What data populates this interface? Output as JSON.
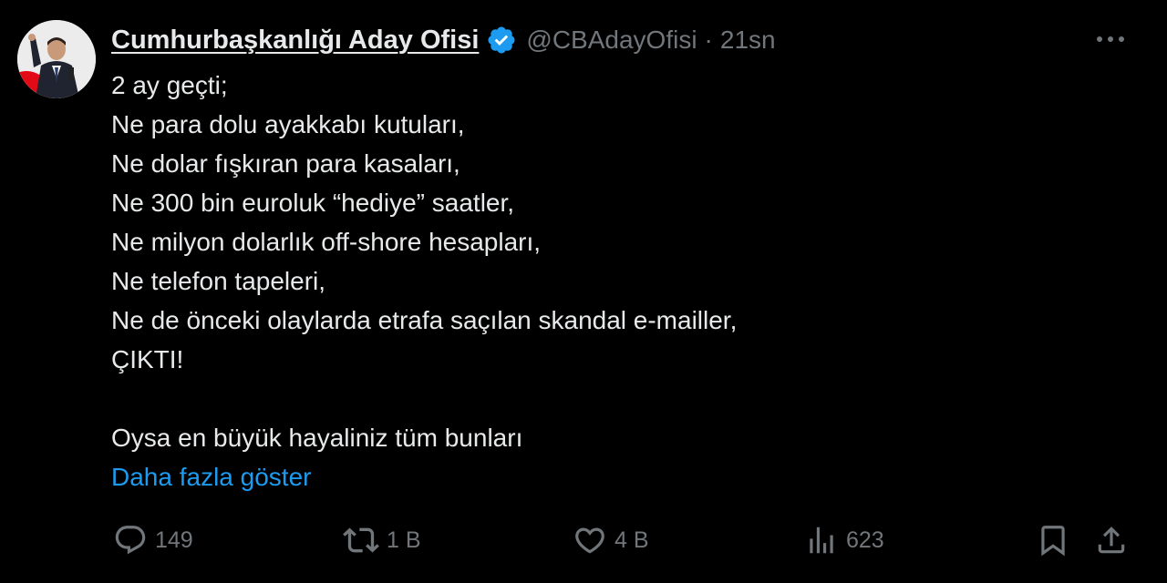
{
  "author": {
    "display_name": "Cumhurbaşkanlığı Aday Ofisi",
    "handle": "@CBAdayOfisi",
    "separator": "·",
    "time": "21sn",
    "verified_icon": "verified-badge-icon",
    "avatar": "profile-photo"
  },
  "tweet": {
    "lines": [
      "2 ay geçti;",
      "Ne para dolu ayakkabı kutuları,",
      "Ne dolar fışkıran para kasaları,",
      "Ne 300 bin euroluk “hediye” saatler,",
      "Ne milyon dolarlık off-shore hesapları,",
      "Ne telefon tapeleri,",
      "Ne de önceki olaylarda etrafa saçılan skandal e-mailler,",
      "ÇIKTI!",
      "",
      "Oysa en büyük hayaliniz tüm bunları"
    ],
    "show_more": "Daha fazla göster"
  },
  "actions": {
    "reply_count": "149",
    "retweet_count": "1 B",
    "like_count": "4 B",
    "views_count": "623",
    "icons": [
      "reply-icon",
      "retweet-icon",
      "like-icon",
      "views-icon",
      "bookmark-icon",
      "share-icon"
    ]
  },
  "colors": {
    "background": "#000000",
    "text": "#e7e9ea",
    "muted": "#71767b",
    "link": "#1d9bf0",
    "verified": "#1d9bf0"
  }
}
